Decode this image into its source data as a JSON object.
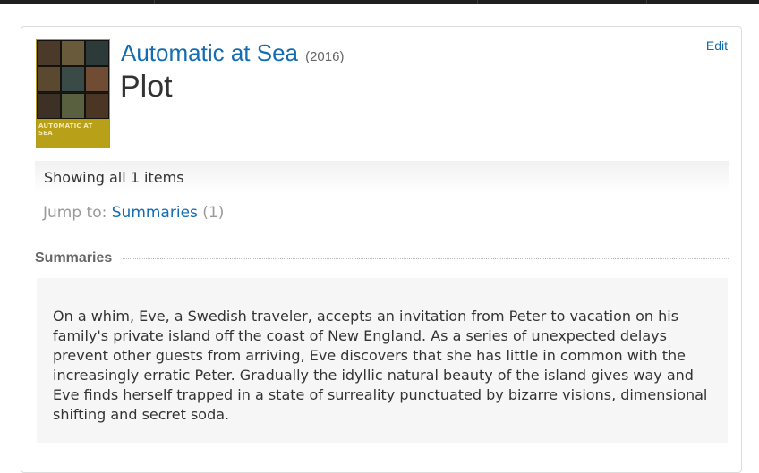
{
  "title": {
    "name": "Automatic at Sea",
    "year": "(2016)"
  },
  "page_heading": "Plot",
  "poster": {
    "text": "AUTOMATIC AT SEA"
  },
  "edit_label": "Edit",
  "showing_text": "Showing all 1 items",
  "jump": {
    "label": "Jump to:",
    "link": "Summaries",
    "count": "(1)"
  },
  "section": {
    "title": "Summaries"
  },
  "summary": {
    "text": "On a whim, Eve, a Swedish traveler, accepts an invitation from Peter to vacation on his family's private island off the coast of New England. As a series of unexpected delays prevent other guests from arriving, Eve discovers that she has little in common with the increasingly erratic Peter. Gradually the idyllic natural beauty of the island gives way and Eve finds herself trapped in a state of surreality punctuated by bizarre visions, dimensional shifting and secret soda."
  },
  "colors": {
    "link": "#136cb2",
    "heading": "#333333",
    "muted": "#999999"
  }
}
